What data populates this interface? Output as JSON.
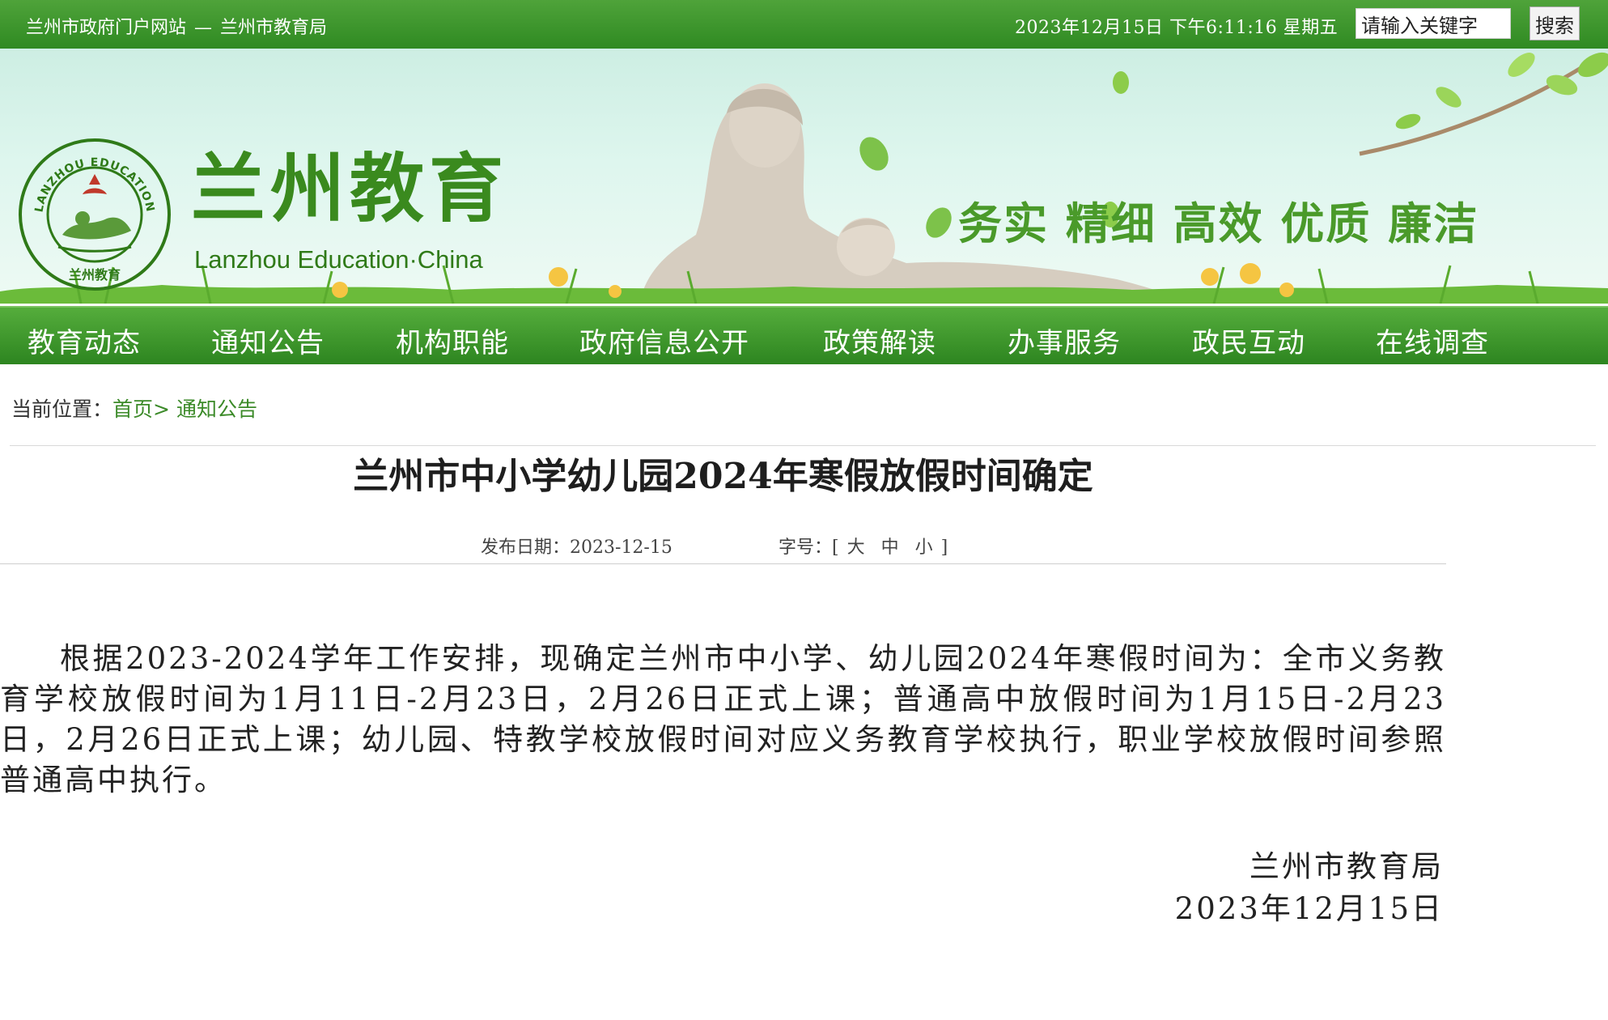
{
  "topbar": {
    "portal_link": "兰州市政府门户网站",
    "separator": "—",
    "bureau_link": "兰州市教育局",
    "clock": "2023年12月15日  下午6:11:16  星期五",
    "search_placeholder": "请输入关键字",
    "search_button": "搜索"
  },
  "banner": {
    "title": "兰州教育",
    "subtitle": "Lanzhou Education·China",
    "logo_text": "LANZHOU EDUCATION",
    "logo_bottom_text": "兰州教育",
    "slogan": "务实 精细 高效 优质 廉洁"
  },
  "nav": {
    "items": [
      "教育动态",
      "通知公告",
      "机构职能",
      "政府信息公开",
      "政策解读",
      "办事服务",
      "政民互动",
      "在线调查"
    ]
  },
  "breadcrumb": {
    "label": "当前位置：",
    "home": "首页",
    "arrow": ">",
    "current": "通知公告"
  },
  "article": {
    "title": "兰州市中小学幼儿园2024年寒假放假时间确定",
    "date_label": "发布日期：",
    "date": "2023-12-15",
    "font_label": "字号：",
    "bracket_open": "[",
    "bracket_close": "]",
    "size_large": "大",
    "size_medium": "中",
    "size_small": "小",
    "body": "根据2023-2024学年工作安排，现确定兰州市中小学、幼儿园2024年寒假时间为：全市义务教育学校放假时间为1月11日-2月23日，2月26日正式上课；普通高中放假时间为1月15日-2月23日，2月26日正式上课；幼儿园、特教学校放假时间对应义务教育学校执行，职业学校放假时间参照普通高中执行。",
    "signature": "兰州市教育局",
    "sign_date": "2023年12月15日"
  },
  "colors": {
    "brand_green": "#2f8a22",
    "link_green": "#3b8a28"
  }
}
